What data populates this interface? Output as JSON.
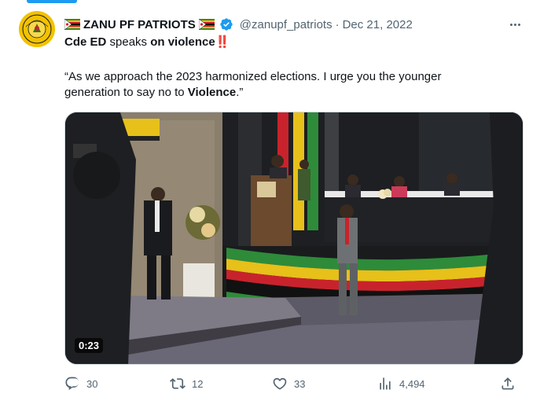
{
  "tweet": {
    "author": {
      "name": "ZANU PF PATRIOTS",
      "handle": "@zanupf_patriots",
      "separator": "·",
      "date": "Dec 21, 2022"
    },
    "text": {
      "line1_part1": "Cde ED",
      "line1_part2": " speaks ",
      "line1_part3": "on violence",
      "line1_emoji": "‼️",
      "line2": "“As we approach the 2023 harmonized elections. I urge you the younger",
      "line3_part1": "generation to say no to ",
      "line3_part2": "Violence",
      "line3_part3": ".”"
    },
    "media": {
      "duration": "0:23"
    },
    "stats": {
      "replies": "30",
      "retweets": "12",
      "likes": "33",
      "views": "4,494"
    }
  },
  "icons": {
    "avatar": "zanu-pf-logo",
    "flag": "zimbabwe-flag-icon",
    "verified": "verified-badge-icon",
    "more": "more-icon",
    "reply": "reply-icon",
    "retweet": "retweet-icon",
    "like": "heart-icon",
    "views": "views-icon",
    "share": "share-icon"
  },
  "colors": {
    "accent": "#1d9bf0",
    "secondary_text": "#536471",
    "primary_text": "#0f1419"
  }
}
